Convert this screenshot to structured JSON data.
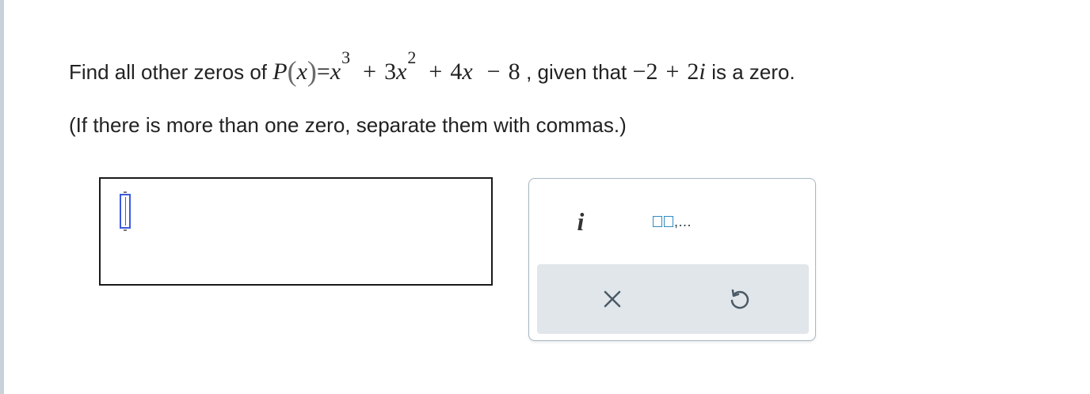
{
  "question": {
    "prefix": "Find all other zeros of",
    "function_name": "P",
    "variable": "x",
    "equals": "=",
    "term1_base": "x",
    "term1_exp": "3",
    "plus": "+",
    "term2_coef": "3",
    "term2_base": "x",
    "term2_exp": "2",
    "term3": "4",
    "term3_var": "x",
    "minus": "−",
    "term4": "8",
    "given_text": ", given that",
    "given_sign": "−",
    "given_real": "2",
    "given_imag_coef": "2",
    "given_imag_unit": "i",
    "suffix": "is a zero."
  },
  "instruction": "(If there is more than one zero, separate them with commas.)",
  "palette": {
    "imaginary_unit_label": "i",
    "list_label": ",...",
    "clear_label": "clear",
    "undo_label": "undo"
  },
  "colors": {
    "cursor": "#3b5bdb",
    "list_squares": "#2f8cc2",
    "action_bar": "#e1e6ea",
    "palette_border": "#a9b7c2",
    "icon": "#4a5a66"
  },
  "icons": {
    "clear": "close-icon",
    "undo": "undo-icon"
  }
}
